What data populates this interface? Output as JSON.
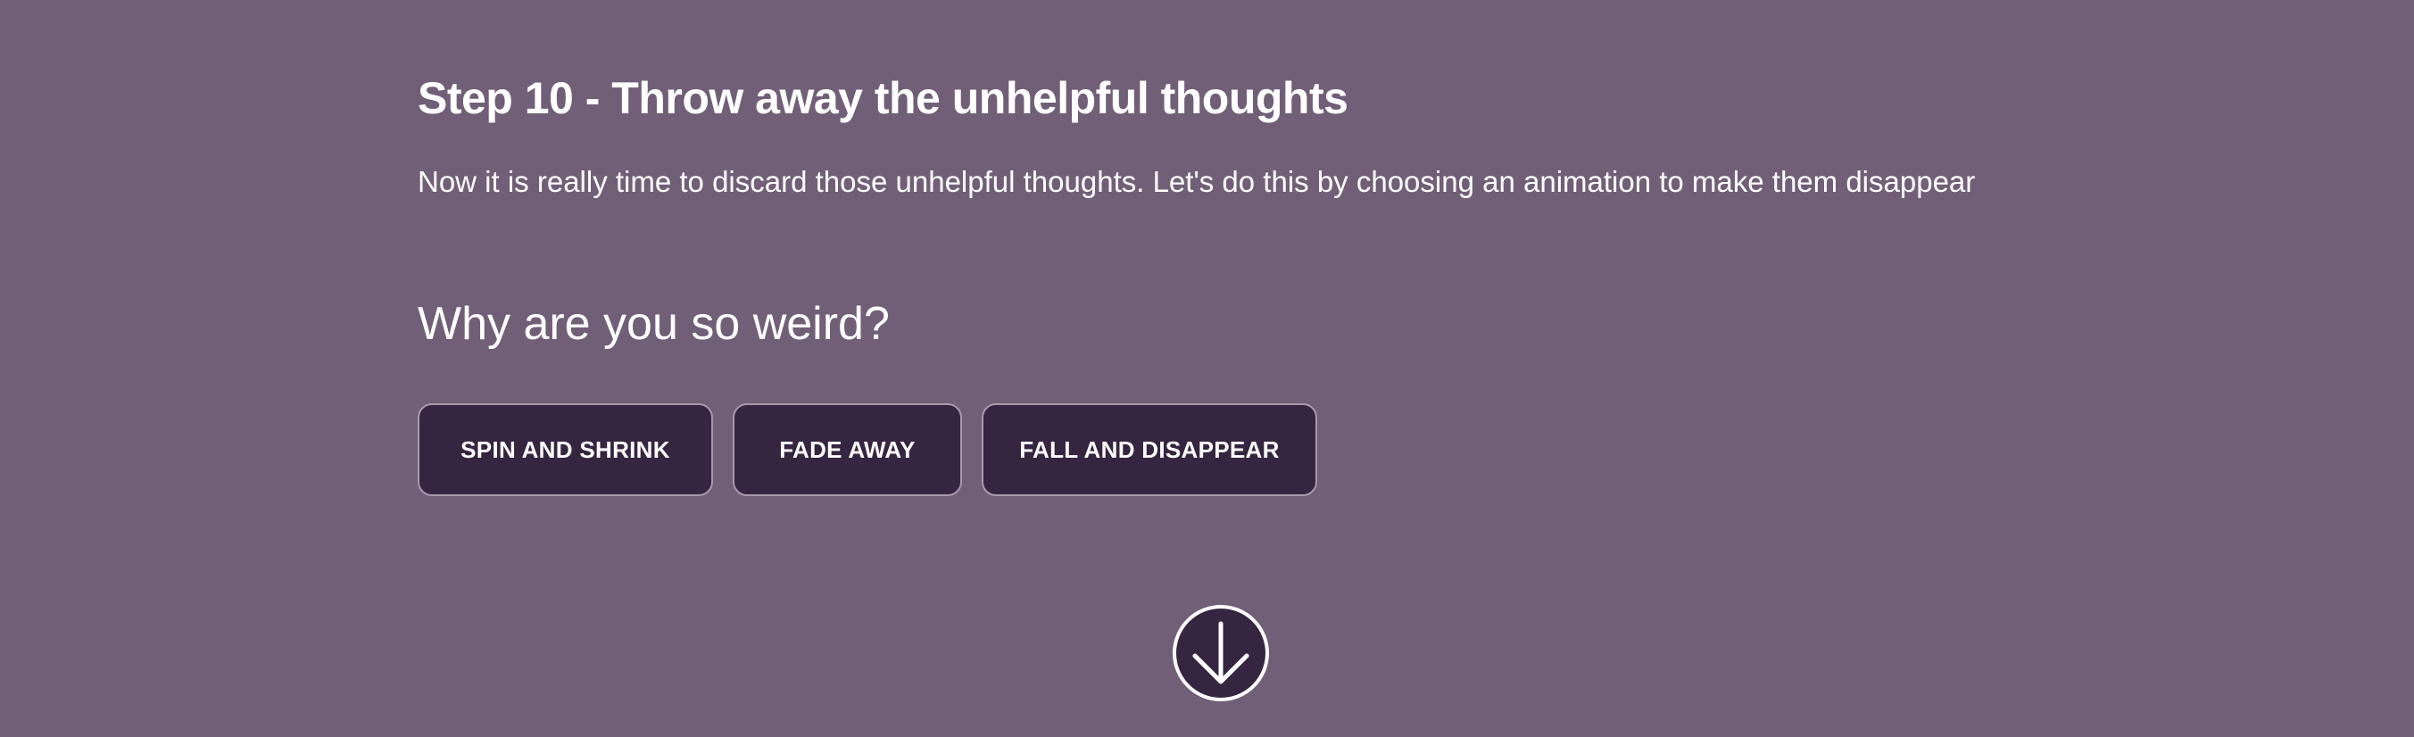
{
  "step": {
    "title": "Step 10 - Throw away the unhelpful thoughts",
    "description": "Now it is really time to discard those unhelpful thoughts. Let's do this by choosing an animation to make them disappear"
  },
  "thought": {
    "text": "Why are you so weird?"
  },
  "animation_buttons": {
    "spin_label": "SPIN AND SHRINK",
    "fade_label": "FADE AWAY",
    "fall_label": "FALL AND DISAPPEAR"
  },
  "scroll_button": {
    "icon": "arrow-down-icon"
  },
  "colors": {
    "background": "#715f78",
    "button_fill": "#362540",
    "button_border": "#a898ad",
    "text": "#ffffff"
  }
}
